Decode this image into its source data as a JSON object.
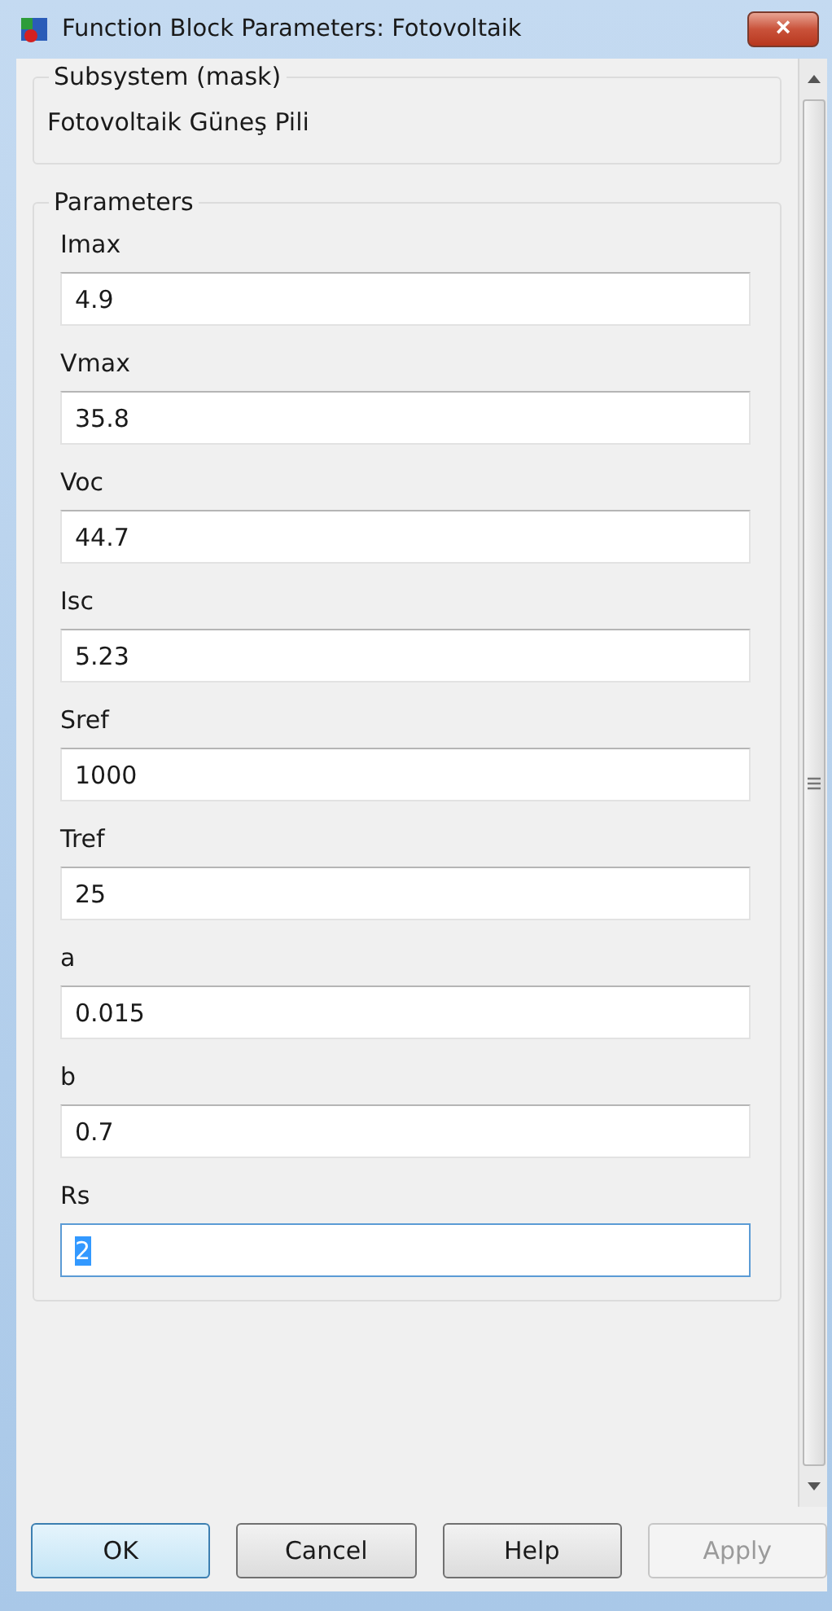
{
  "window": {
    "title": "Function Block Parameters: Fotovoltaik",
    "close": "×"
  },
  "description": {
    "heading": "Subsystem (mask)",
    "text": "Fotovoltaik Güneş Pili"
  },
  "parameters": {
    "heading": "Parameters",
    "items": [
      {
        "label": "Imax",
        "value": "4.9",
        "focused": false
      },
      {
        "label": "Vmax",
        "value": "35.8",
        "focused": false
      },
      {
        "label": "Voc",
        "value": "44.7",
        "focused": false
      },
      {
        "label": "Isc",
        "value": "5.23",
        "focused": false
      },
      {
        "label": "Sref",
        "value": "1000",
        "focused": false
      },
      {
        "label": "Tref",
        "value": "25",
        "focused": false
      },
      {
        "label": "a",
        "value": "0.015",
        "focused": false
      },
      {
        "label": "b",
        "value": "0.7",
        "focused": false
      },
      {
        "label": "Rs",
        "value": "2",
        "focused": true
      }
    ]
  },
  "buttons": [
    {
      "label": "OK",
      "default": true,
      "disabled": false
    },
    {
      "label": "Cancel",
      "default": false,
      "disabled": false
    },
    {
      "label": "Help",
      "default": false,
      "disabled": false
    },
    {
      "label": "Apply",
      "default": false,
      "disabled": true
    }
  ]
}
